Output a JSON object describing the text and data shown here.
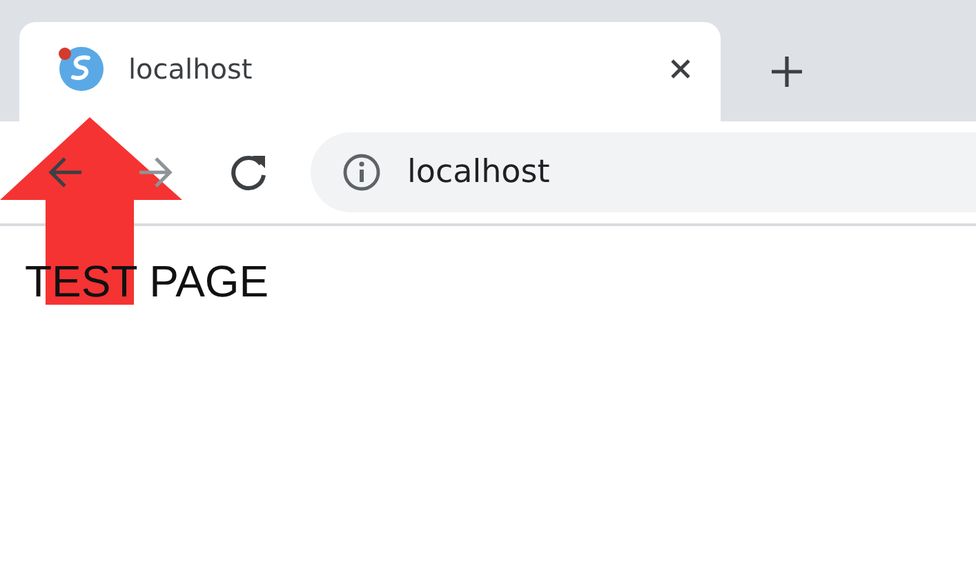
{
  "tab": {
    "title": "localhost"
  },
  "address_bar": {
    "url": "localhost"
  },
  "page": {
    "heading": "TEST PAGE"
  }
}
